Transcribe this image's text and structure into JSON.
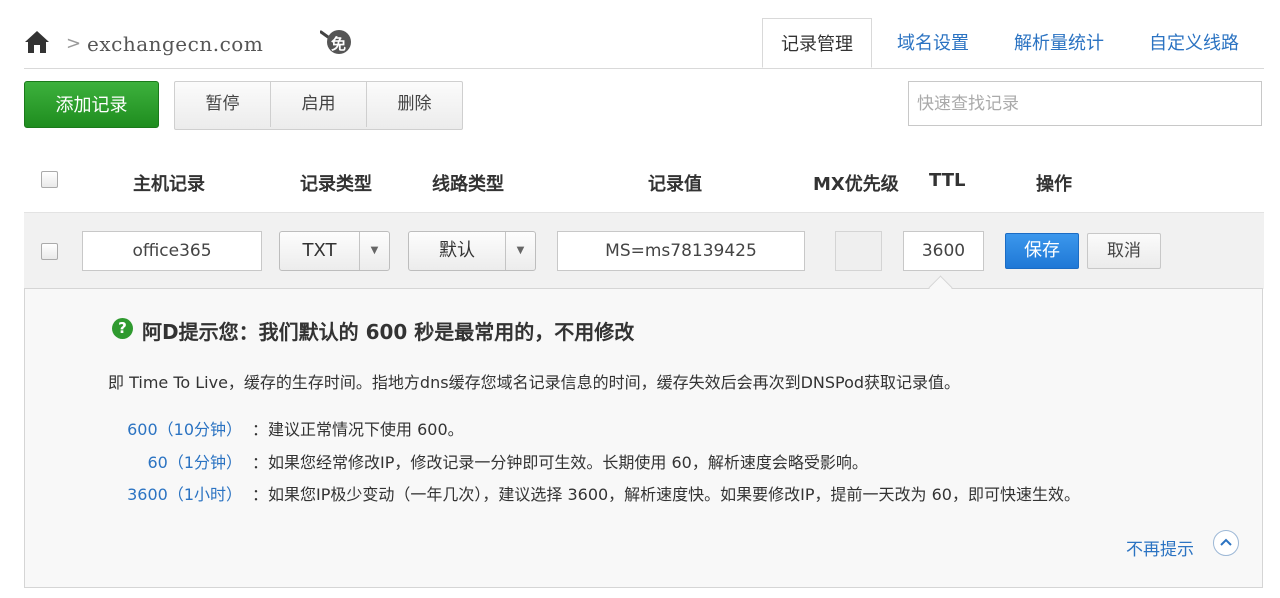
{
  "breadcrumb": {
    "domain": "exchangecn.com",
    "separator": ">",
    "badge_glyph": "免"
  },
  "tabs": [
    {
      "label": "记录管理",
      "active": true
    },
    {
      "label": "域名设置",
      "active": false
    },
    {
      "label": "解析量统计",
      "active": false
    },
    {
      "label": "自定义线路",
      "active": false
    }
  ],
  "toolbar": {
    "add_label": "添加记录",
    "pause_label": "暂停",
    "enable_label": "启用",
    "delete_label": "删除",
    "search_placeholder": "快速查找记录"
  },
  "table_headers": {
    "host": "主机记录",
    "type": "记录类型",
    "line": "线路类型",
    "value": "记录值",
    "mx": "MX优先级",
    "ttl": "TTL",
    "action": "操作"
  },
  "edit_row": {
    "host": "office365",
    "type": "TXT",
    "line": "默认",
    "value": "MS=ms78139425",
    "mx": "",
    "ttl": "3600",
    "save_label": "保存",
    "cancel_label": "取消"
  },
  "ttl_tip": {
    "title": "阿D提示您：我们默认的 600 秒是最常用的，不用修改",
    "description": "即 Time To Live，缓存的生存时间。指地方dns缓存您域名记录信息的时间，缓存失效后会再次到DNSPod获取记录值。",
    "options": [
      {
        "value": "600（10分钟）",
        "text": "：建议正常情况下使用 600。"
      },
      {
        "value": "60（1分钟）",
        "text": "：如果您经常修改IP，修改记录一分钟即可生效。长期使用 60，解析速度会略受影响。"
      },
      {
        "value": "3600（1小时）",
        "text": "：如果您IP极少变动（一年几次），建议选择 3600，解析速度快。如果要修改IP，提前一天改为 60，即可快速生效。"
      }
    ],
    "dismiss_label": "不再提示"
  },
  "colors": {
    "primary_green": "#1f8d1f",
    "link_blue": "#2b73c2",
    "save_blue": "#1f78d6"
  }
}
